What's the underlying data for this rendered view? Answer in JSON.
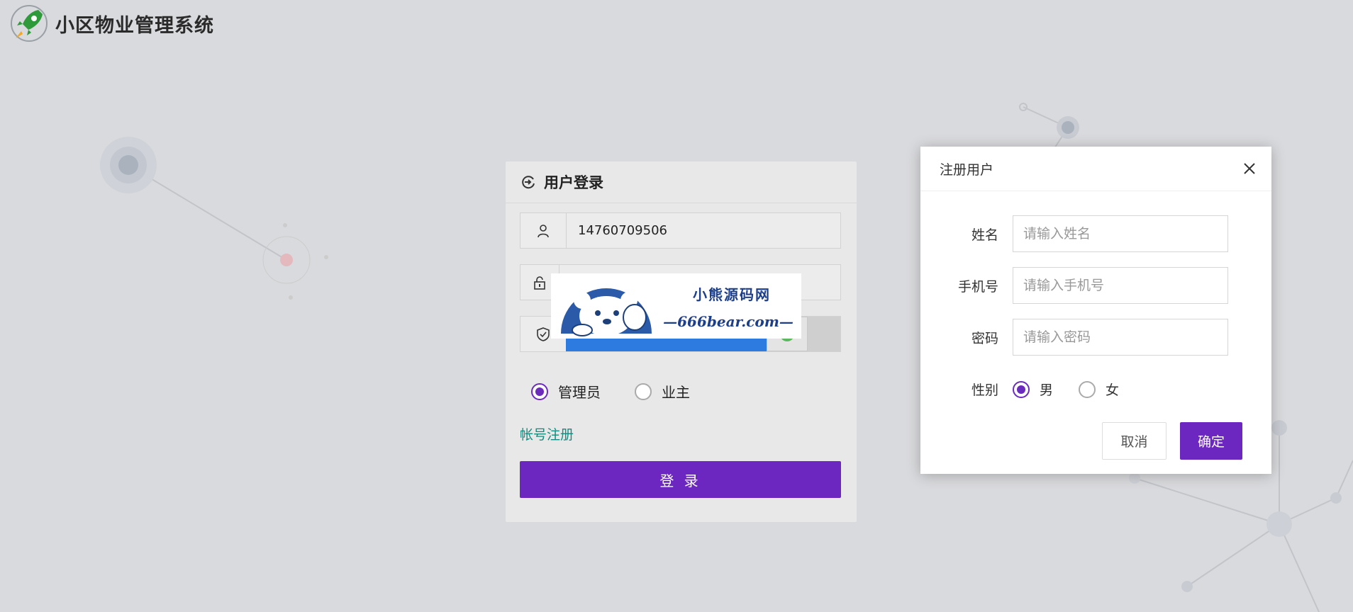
{
  "app": {
    "title": "小区物业管理系统"
  },
  "login": {
    "title": "用户登录",
    "username_value": "14760709506",
    "password_value": "",
    "roles": [
      {
        "label": "管理员",
        "selected": true
      },
      {
        "label": "业主",
        "selected": false
      }
    ],
    "register_link": "帐号注册",
    "submit_label": "登 录"
  },
  "watermark": {
    "line1": "小熊源码网",
    "line2": "—666bear.com—"
  },
  "dialog": {
    "title": "注册用户",
    "fields": [
      {
        "label": "姓名",
        "placeholder": "请输入姓名"
      },
      {
        "label": "手机号",
        "placeholder": "请输入手机号"
      },
      {
        "label": "密码",
        "placeholder": "请输入密码"
      }
    ],
    "gender": {
      "label": "性别",
      "options": [
        {
          "label": "男",
          "selected": true
        },
        {
          "label": "女",
          "selected": false
        }
      ]
    },
    "cancel_label": "取消",
    "ok_label": "确定"
  },
  "colors": {
    "accent": "#6b27bf",
    "link": "#128c7e",
    "slider": "#2d7be0",
    "background": "#d9dadd"
  }
}
